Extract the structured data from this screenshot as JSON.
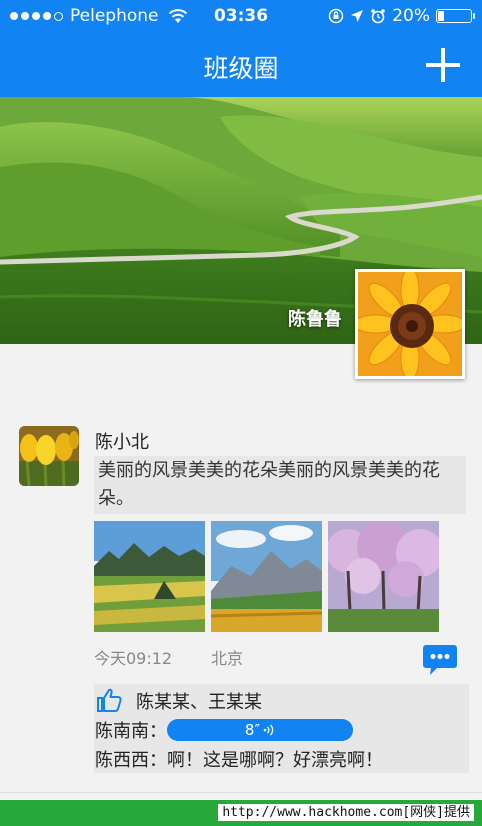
{
  "status_bar": {
    "carrier": "Pelephone",
    "time": "03:36",
    "battery": "20%",
    "battery_level": 0.2
  },
  "nav": {
    "title": "班级圈",
    "add_icon": "plus-icon"
  },
  "cover": {
    "owner_name": "陈鲁鲁"
  },
  "post": {
    "author": "陈小北",
    "text": "美丽的风景美美的花朵美丽的风景美美的花朵。",
    "time": "今天09:12",
    "location": "北京",
    "likers": "陈某某、王某某",
    "comments": [
      {
        "author": "陈南南：",
        "voice_duration": "8″"
      },
      {
        "author": "陈西西：",
        "text": "啊！这是哪啊？好漂亮啊！"
      }
    ]
  },
  "watermark": "http://www.hackhome.com[网侠]提供",
  "colors": {
    "accent": "#1283f2",
    "bottom_bar": "#27a83a"
  }
}
